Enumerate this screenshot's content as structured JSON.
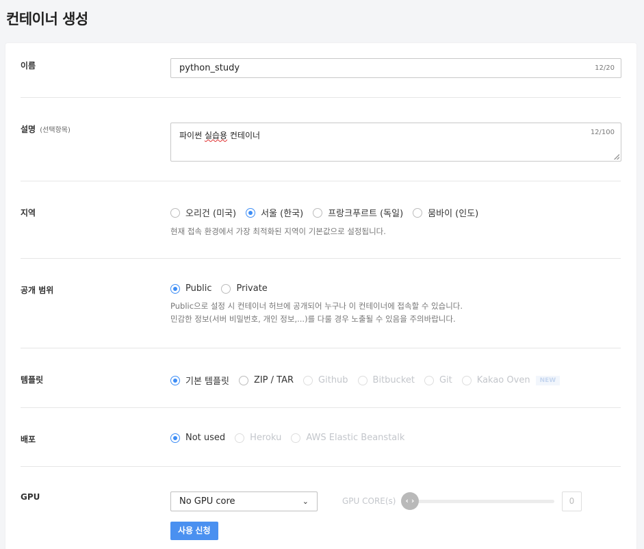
{
  "page": {
    "title": "컨테이너 생성"
  },
  "name": {
    "label": "이름",
    "value": "python_study",
    "counter": "12/20"
  },
  "description": {
    "label": "설명",
    "optional": "(선택항목)",
    "value_before": "파이썬 ",
    "value_misspelled": "실습용",
    "value_after": " 컨테이너",
    "counter": "12/100"
  },
  "region": {
    "label": "지역",
    "options": [
      {
        "label": "오리건 (미국)",
        "selected": false
      },
      {
        "label": "서울 (한국)",
        "selected": true
      },
      {
        "label": "프랑크푸르트 (독일)",
        "selected": false
      },
      {
        "label": "뭄바이 (인도)",
        "selected": false
      }
    ],
    "help": "현재 접속 환경에서 가장 최적화된 지역이 기본값으로 설정됩니다."
  },
  "visibility": {
    "label": "공개 범위",
    "options": [
      {
        "label": "Public",
        "selected": true
      },
      {
        "label": "Private",
        "selected": false
      }
    ],
    "help_line1": "Public으로 설정 시 컨테이너 허브에 공개되어 누구나 이 컨테이너에 접속할 수 있습니다.",
    "help_line2": "민감한 정보(서버 비밀번호, 개인 정보,...)를 다룰 경우 노출될 수 있음을 주의바랍니다."
  },
  "template": {
    "label": "템플릿",
    "options": [
      {
        "label": "기본 템플릿",
        "selected": true,
        "disabled": false
      },
      {
        "label": "ZIP / TAR",
        "selected": false,
        "disabled": false
      },
      {
        "label": "Github",
        "selected": false,
        "disabled": true
      },
      {
        "label": "Bitbucket",
        "selected": false,
        "disabled": true
      },
      {
        "label": "Git",
        "selected": false,
        "disabled": true
      },
      {
        "label": "Kakao Oven",
        "selected": false,
        "disabled": true
      }
    ],
    "new_badge": "NEW"
  },
  "deploy": {
    "label": "배포",
    "options": [
      {
        "label": "Not used",
        "selected": true,
        "disabled": false
      },
      {
        "label": "Heroku",
        "selected": false,
        "disabled": true
      },
      {
        "label": "AWS Elastic Beanstalk",
        "selected": false,
        "disabled": true
      }
    ]
  },
  "gpu": {
    "label": "GPU",
    "select_value": "No GPU core",
    "core_label": "GPU CORE(s)",
    "core_value": "0",
    "slider_knob": "‹ ›",
    "apply_button": "사용 신청"
  },
  "colors": {
    "accent": "#3d8df5",
    "button": "#4a90f0",
    "disabled": "#c3c6cb"
  },
  "icons": {
    "select_chevron": "chevron-down-icon",
    "slider_knob": "slider-arrows-icon"
  }
}
